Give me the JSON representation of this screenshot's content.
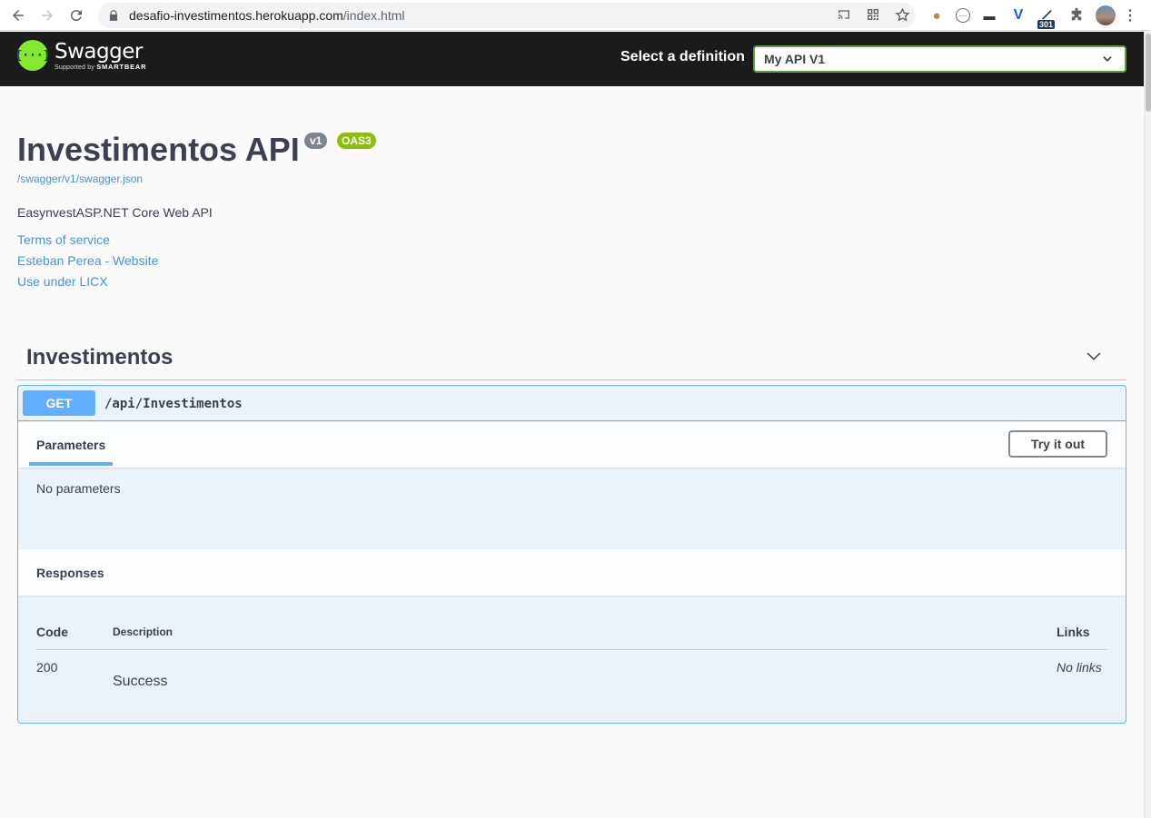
{
  "browser": {
    "url_host": "desafio-investimentos.herokuapp.com",
    "url_path": "/index.html",
    "ext_badge": "301"
  },
  "topbar": {
    "logo_title": "Swagger",
    "logo_sub_prefix": "Supported by",
    "logo_sub_brand": "SMARTBEAR",
    "definition_label": "Select a definition",
    "definition_value": "My API V1"
  },
  "info": {
    "title": "Investimentos API",
    "version": "v1",
    "oas": "OAS3",
    "spec_url": "/swagger/v1/swagger.json",
    "description": "EasynvestASP.NET Core Web API",
    "links": [
      "Terms of service",
      "Esteban Perea - Website",
      "Use under LICX"
    ]
  },
  "tag": {
    "name": "Investimentos",
    "operation": {
      "method": "GET",
      "path": "/api/Investimentos",
      "parameters_tab": "Parameters",
      "try_it_out": "Try it out",
      "no_parameters": "No parameters",
      "responses_title": "Responses",
      "columns": {
        "code": "Code",
        "description": "Description",
        "links": "Links"
      },
      "responses": [
        {
          "code": "200",
          "description": "Success",
          "links": "No links"
        }
      ]
    }
  },
  "colors": {
    "get_blue": "#61affe",
    "swagger_green": "#85ea2d",
    "oas_green": "#89bf04",
    "topbar_bg": "#1b1b1b"
  }
}
